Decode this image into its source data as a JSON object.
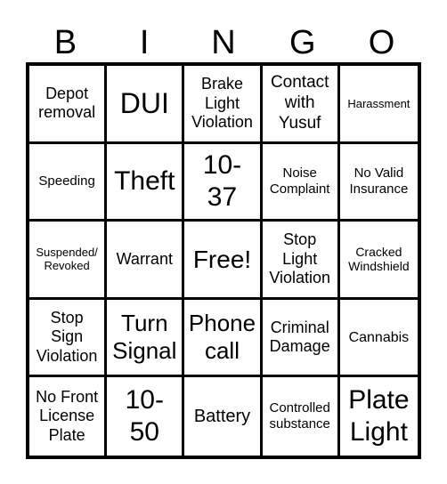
{
  "header": [
    "B",
    "I",
    "N",
    "G",
    "O"
  ],
  "cells": [
    "Depot\nremoval",
    "DUI",
    "Brake\nLight\nViolation",
    "Contact\nwith\nYusuf",
    "Harassment",
    "Speeding",
    "Theft",
    "10-\n37",
    "Noise\nComplaint",
    "No Valid\nInsurance",
    "Suspended/\nRevoked",
    "Warrant",
    "Free!",
    "Stop\nLight\nViolation",
    "Cracked\nWindshield",
    "Stop\nSign\nViolation",
    "Turn\nSignal",
    "Phone\ncall",
    "Criminal\nDamage",
    "Cannabis",
    "No Front\nLicense\nPlate",
    "10-\n50",
    "Battery",
    "Controlled\nsubstance",
    "Plate\nLight"
  ]
}
